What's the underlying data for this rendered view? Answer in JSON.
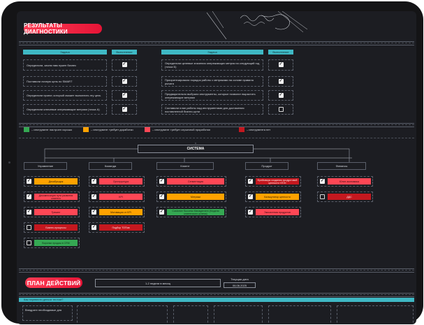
{
  "header": {
    "title": "РЕЗУЛЬТАТЫ ДИАГНОСТИКИ"
  },
  "tasks": {
    "col_task": "Задача",
    "col_done": "Выполнение",
    "left": [
      {
        "text": "Определили, зачем нам нужен бизнес",
        "done": true
      },
      {
        "text": "Поставили личную цель по SMART",
        "done": true
      },
      {
        "text": "Определили проект, который сможет выполнить эту цель",
        "done": true
      },
      {
        "text": "Определили ключевые опережающие метрики (точка А)",
        "done": true
      }
    ],
    "right": [
      {
        "text": "Определили целевые значения опережающих метрик на следующий год (точка Б)",
        "done": true
      },
      {
        "text": "Приоритезировали порядок работы с метриками на основе правила рычага",
        "done": true
      },
      {
        "text": "Предварительно выбрали инструменты, которые позволят вырастить опережающие метрики",
        "done": true
      },
      {
        "text": "Составили план работы над инструментами для достижения поставленной бизнес-цели",
        "done": false
      }
    ]
  },
  "legend": [
    {
      "label": "– инструмент настроен хорошо",
      "color": "#35a853"
    },
    {
      "label": "– инструмент требует доработки",
      "color": "#ffa200"
    },
    {
      "label": "– инструмент требует серьезной проработки",
      "color": "#ff4755"
    },
    {
      "label": "– инструмента нет",
      "color": "#c4181f"
    }
  ],
  "system": {
    "title": "СИСТЕМА",
    "categories": [
      {
        "name": "Управление",
        "items": [
          {
            "label": "Декабрьщик",
            "color": "orange",
            "checked": true
          },
          {
            "label": "Декомпозиция пути развития клиента",
            "color": "pink",
            "checked": true
          },
          {
            "label": "Трекинг",
            "color": "pink",
            "checked": true
          },
          {
            "label": "Бизнес-процессы",
            "color": "red",
            "checked": false
          },
          {
            "label": "Воронки продаж в CRM",
            "color": "green",
            "checked": false
          }
        ]
      },
      {
        "name": "Команда",
        "items": [
          {
            "label": "Оргструктура",
            "color": "pink",
            "checked": true
          },
          {
            "label": "KPI",
            "color": "pink",
            "checked": true
          },
          {
            "label": "Мотивация от KPI",
            "color": "orange",
            "checked": true
          },
          {
            "label": "Подбор ТОПов",
            "color": "red",
            "checked": true
          }
        ]
      },
      {
        "name": "Клиент",
        "items": [
          {
            "label": "Сегментация",
            "color": "pink",
            "checked": true
          },
          {
            "label": "Метрики",
            "color": "orange",
            "checked": true
          },
          {
            "label": "Customer Success Management (Модели клиентского успеха)",
            "color": "green",
            "checked": true
          }
        ]
      },
      {
        "name": "Продукт",
        "items": [
          {
            "label": "Фреймворк создания продуктовой ценности «ПЭ»",
            "color": "red",
            "checked": true
          },
          {
            "label": "Калькулятор ценности",
            "color": "orange",
            "checked": true
          },
          {
            "label": "Экосистема продуктов",
            "color": "pink",
            "checked": true
          }
        ]
      },
      {
        "name": "Финансы",
        "items": [
          {
            "label": "Юнит-экономика",
            "color": "pink",
            "checked": true
          },
          {
            "label": "ДДС",
            "color": "red",
            "checked": false
          }
        ]
      }
    ]
  },
  "plan": {
    "title": "ПЛАН ДЕЙСТВИЙ",
    "period": "1-2 недели в месяц",
    "current_date_label": "Текущая дата",
    "current_date": "06.06.2025",
    "table_header": "Как перевести деньги тестом?",
    "first_cell": "Внедрите необходимые для"
  }
}
